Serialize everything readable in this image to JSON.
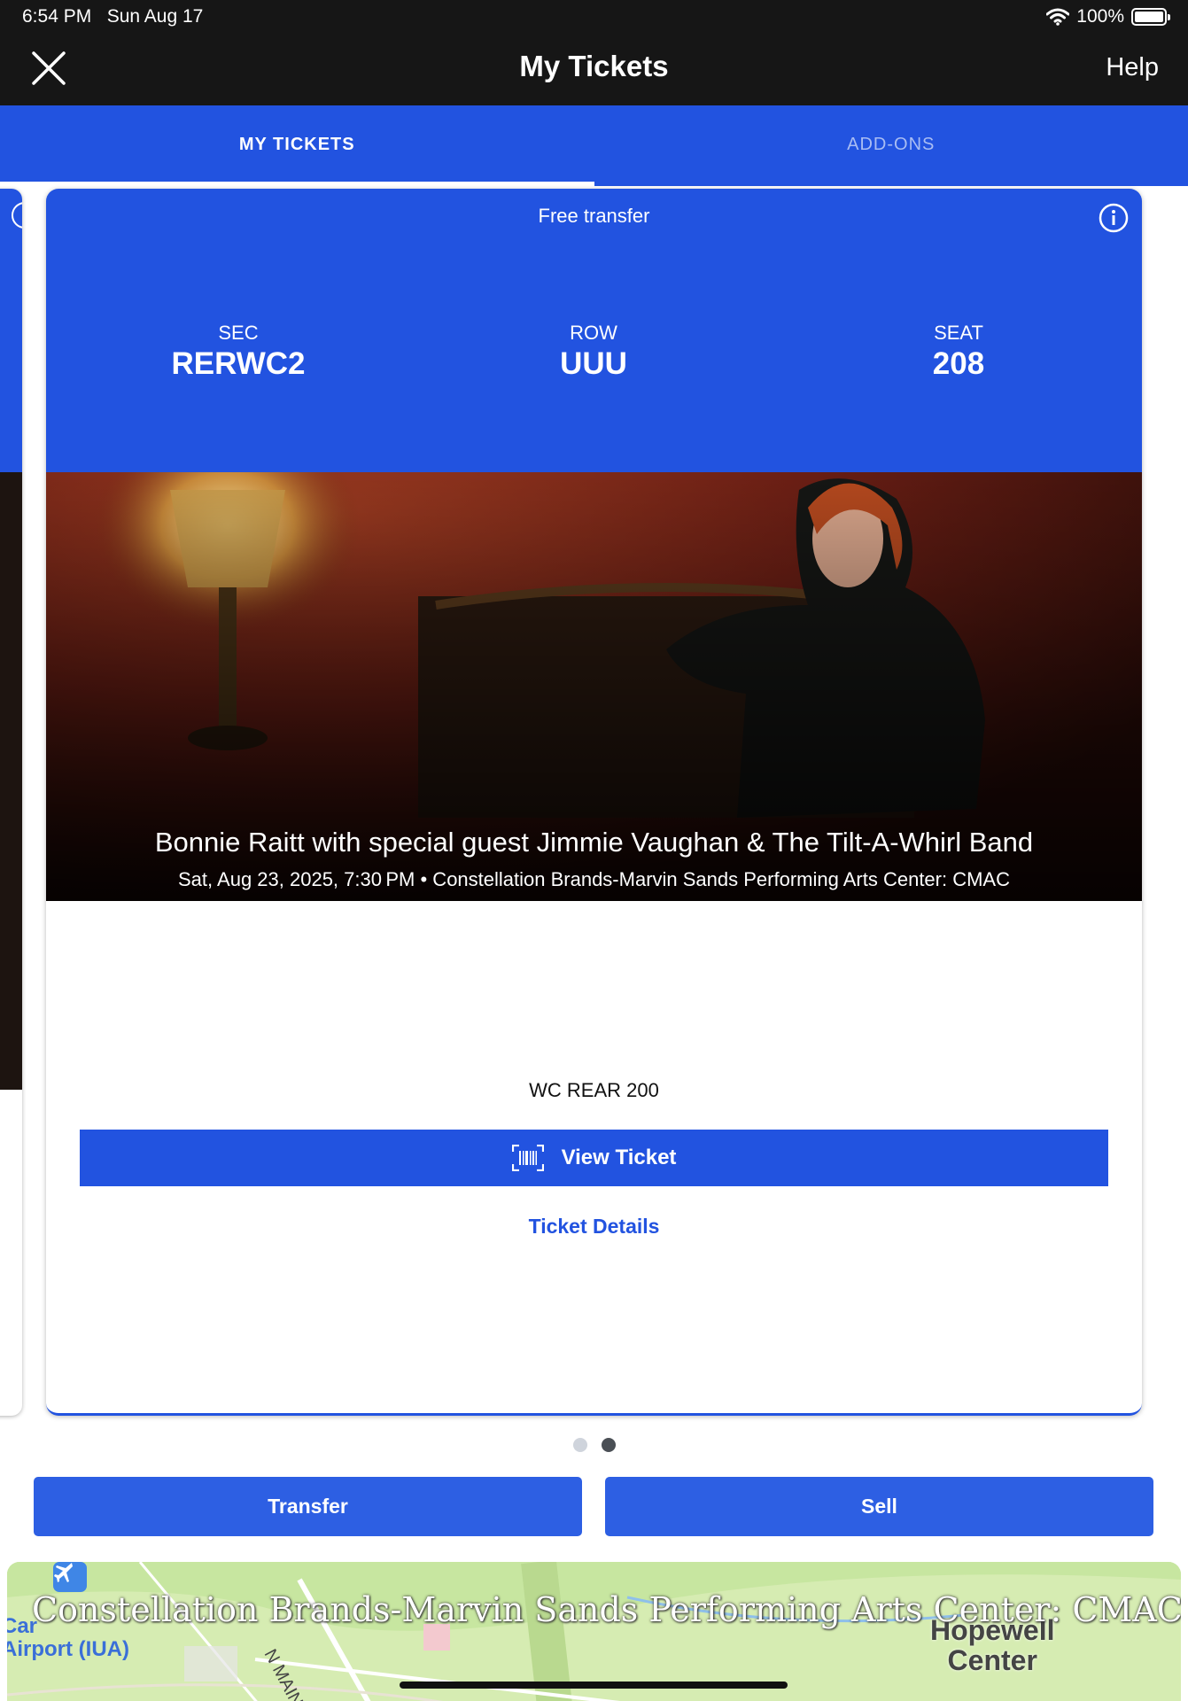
{
  "status_bar": {
    "time": "6:54 PM",
    "date": "Sun Aug 17",
    "battery": "100%"
  },
  "header": {
    "title": "My Tickets",
    "help_label": "Help"
  },
  "tabs": [
    {
      "label": "MY TICKETS",
      "active": true
    },
    {
      "label": "ADD-ONS",
      "active": false
    }
  ],
  "ticket": {
    "transfer_label": "Free transfer",
    "sec_label": "SEC",
    "sec_value": "RERWC2",
    "row_label": "ROW",
    "row_value": "UUU",
    "seat_label": "SEAT",
    "seat_value": "208",
    "event_title": "Bonnie Raitt with special guest Jimmie Vaughan & The Tilt-A-Whirl Band",
    "event_subtitle": "Sat, Aug 23, 2025, 7:30 PM • Constellation Brands-Marvin Sands Performing Arts Center: CMAC",
    "section_name": "WC REAR 200",
    "view_ticket_label": "View Ticket",
    "ticket_details_label": "Ticket Details"
  },
  "pager": {
    "count": 2,
    "active_index": 1
  },
  "actions": {
    "transfer_label": "Transfer",
    "sell_label": "Sell"
  },
  "map": {
    "venue_label": "Constellation Brands-Marvin Sands Performing Arts Center: CMAC",
    "airport_label_line1": "Car",
    "airport_label_line2": "Airport (IUA)",
    "town_line1": "Hopewell",
    "town_line2": "Center",
    "road_label": "N MAIN S"
  },
  "colors": {
    "brand_blue": "#2253e0",
    "header_bg": "#161616"
  }
}
